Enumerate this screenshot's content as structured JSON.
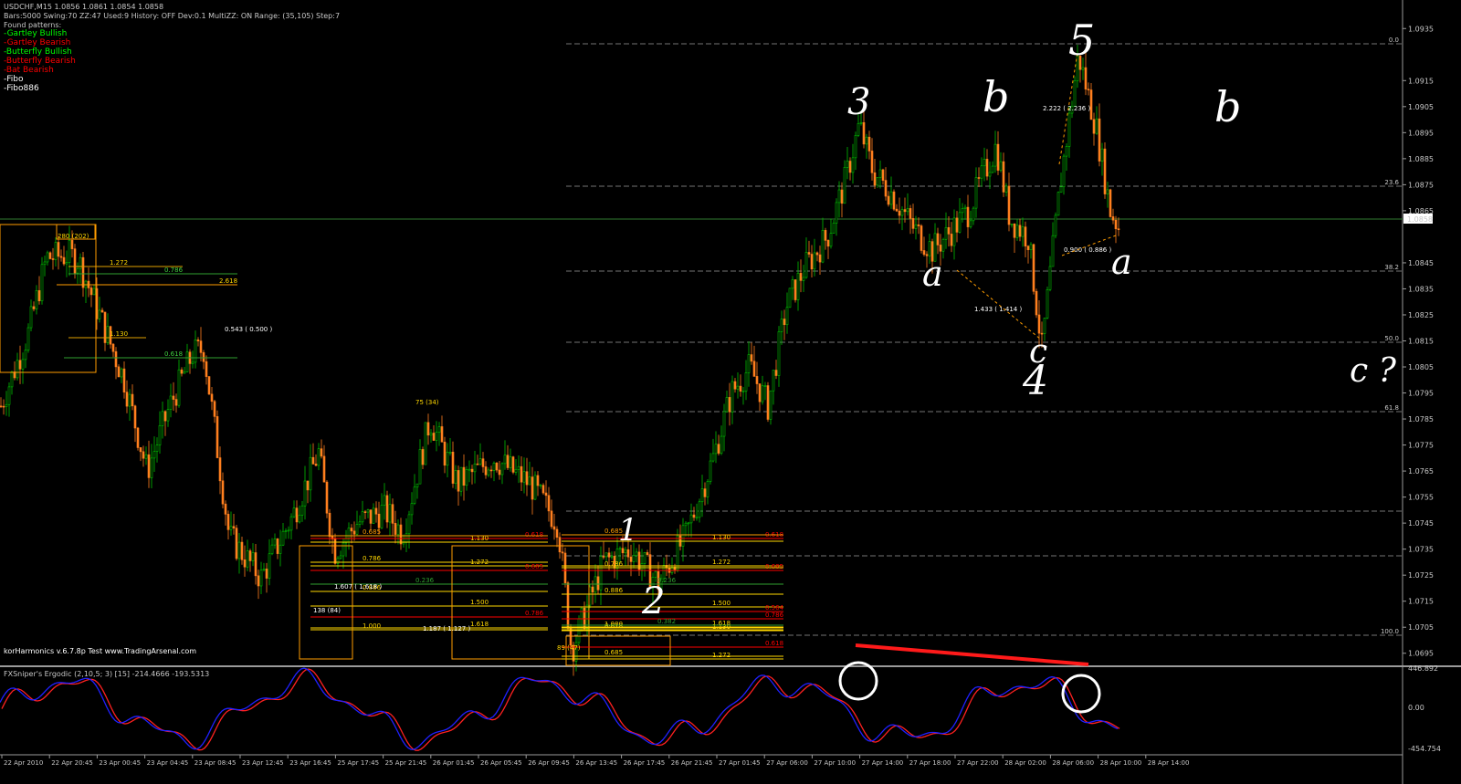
{
  "header": {
    "line1": "USDCHF,M15  1.0856 1.0861 1.0854 1.0858",
    "line2": "Bars:5000  Swing:70  ZZ:47  Used:9  History: OFF Dev:0.1  MultiZZ: ON  Range: (35,105)  Step:7",
    "line3": "Found patterns:"
  },
  "patterns": [
    {
      "label": "-Gartley Bullish",
      "color": "#00ff00"
    },
    {
      "label": "-Gartley Bearish",
      "color": "#ff0000"
    },
    {
      "label": "-Butterfly Bullish",
      "color": "#00ff00"
    },
    {
      "label": "-Butterfly Bearish",
      "color": "#ff0000"
    },
    {
      "label": "-Bat Bearish",
      "color": "#ff0000"
    },
    {
      "label": "-Fibo",
      "color": "#ffffff"
    },
    {
      "label": "-Fibo886",
      "color": "#ffffff"
    }
  ],
  "footer_text": "korHarmonics v.6.7.8p Test www.TradingArsenal.com",
  "indicator": {
    "label": "FXSniper's Ergodic (2,10,5; 3) [15] -214.4666 -193.5313",
    "axis_labels": [
      "446.892",
      "0.00",
      "-454.754"
    ]
  },
  "price_axis": {
    "labels": [
      "1.0935",
      "1.0915",
      "1.0905",
      "1.0895",
      "1.0885",
      "1.0875",
      "1.0865",
      "1.0845",
      "1.0835",
      "1.0825",
      "1.0815",
      "1.0805",
      "1.0795",
      "1.0785",
      "1.0775",
      "1.0765",
      "1.0755",
      "1.0745",
      "1.0735",
      "1.0725",
      "1.0715",
      "1.0705",
      "1.0695"
    ],
    "current_price": "1.0858"
  },
  "fib_levels": [
    "0.0",
    "23.6",
    "38.2",
    "50.0",
    "61.8",
    "100.0"
  ],
  "time_axis": [
    "22 Apr 2010",
    "22 Apr 20:45",
    "23 Apr 00:45",
    "23 Apr 04:45",
    "23 Apr 08:45",
    "23 Apr 12:45",
    "23 Apr 16:45",
    "25 Apr 17:45",
    "25 Apr 21:45",
    "26 Apr 01:45",
    "26 Apr 05:45",
    "26 Apr 09:45",
    "26 Apr 13:45",
    "26 Apr 17:45",
    "26 Apr 21:45",
    "27 Apr 01:45",
    "27 Apr 06:00",
    "27 Apr 10:00",
    "27 Apr 14:00",
    "27 Apr 18:00",
    "27 Apr 22:00",
    "28 Apr 02:00",
    "28 Apr 06:00",
    "28 Apr 10:00",
    "28 Apr 14:00"
  ],
  "wave_labels": {
    "w1": "1",
    "w2": "2",
    "w3": "3",
    "w4": "4",
    "w5": "5",
    "a1": "a",
    "b1": "b",
    "c1": "c",
    "a2": "a",
    "b2": "b",
    "c2": "c ?"
  },
  "ratio_labels": {
    "r1": "2.222 ( 2.236 )",
    "r2": "0.900 ( 0.886 )",
    "r3": "1.433 ( 1.414 )",
    "r4": "0.543 ( 0.500 )",
    "r5": "75 (34)",
    "r6": "280 (202)",
    "r7": "138 (84)",
    "r8": "1.607 ( 1.618 )",
    "r9": "1.187 ( 1.127 )",
    "r10": "89 (47)"
  },
  "harmonic_levels": {
    "h1": [
      "1.272",
      "0.786",
      "2.618",
      "1.130",
      "0.618"
    ],
    "h2": [
      "0.685",
      "1.130",
      "0.618",
      "0.786",
      "1.272",
      "0.685",
      "1.500",
      "0.618",
      "0.786",
      "1.000",
      "1.618",
      "0.236"
    ],
    "h3": [
      "0.685",
      "1.130",
      "0.618",
      "0.786",
      "1.272",
      "0.685",
      "0.886",
      "1.500",
      "0.564",
      "0.382",
      "0.786",
      "1.000",
      "1.618",
      "0.618",
      "1.130",
      "0.685",
      "0.618",
      "1.272",
      "0.236"
    ]
  },
  "colors": {
    "bull": "#00c000",
    "bear": "#ff7f1e",
    "pattern_fill": "#3ea06c",
    "red": "#ff0000",
    "indicator_a": "#2020ff",
    "indicator_b": "#ff2020"
  },
  "chart_data": {
    "type": "candlestick",
    "title": "USDCHF,M15",
    "ylim": [
      1.069,
      1.094
    ],
    "points": [
      [
        0,
        1.079
      ],
      [
        30,
        1.0818
      ],
      [
        50,
        1.0847
      ],
      [
        75,
        1.0848
      ],
      [
        85,
        1.0846
      ],
      [
        135,
        1.08
      ],
      [
        160,
        1.0765
      ],
      [
        185,
        1.079
      ],
      [
        210,
        1.081
      ],
      [
        222,
        1.0812
      ],
      [
        250,
        1.074
      ],
      [
        285,
        1.0724
      ],
      [
        320,
        1.0748
      ],
      [
        348,
        1.0772
      ],
      [
        365,
        1.0734
      ],
      [
        390,
        1.0745
      ],
      [
        420,
        1.075
      ],
      [
        440,
        1.0741
      ],
      [
        470,
        1.0785
      ],
      [
        500,
        1.076
      ],
      [
        540,
        1.077
      ],
      [
        580,
        1.076
      ],
      [
        610,
        1.0745
      ],
      [
        625,
        1.0696
      ],
      [
        660,
        1.073
      ],
      [
        690,
        1.0735
      ],
      [
        720,
        1.0722
      ],
      [
        750,
        1.074
      ],
      [
        780,
        1.077
      ],
      [
        800,
        1.0795
      ],
      [
        820,
        1.0805
      ],
      [
        840,
        1.079
      ],
      [
        860,
        1.0828
      ],
      [
        880,
        1.0843
      ],
      [
        905,
        1.0855
      ],
      [
        925,
        1.0877
      ],
      [
        940,
        1.0898
      ],
      [
        955,
        1.088
      ],
      [
        975,
        1.0872
      ],
      [
        1000,
        1.0858
      ],
      [
        1020,
        1.085
      ],
      [
        1040,
        1.0857
      ],
      [
        1060,
        1.0865
      ],
      [
        1075,
        1.0878
      ],
      [
        1090,
        1.089
      ],
      [
        1105,
        1.0862
      ],
      [
        1125,
        1.0855
      ],
      [
        1140,
        1.0812
      ],
      [
        1160,
        1.0875
      ],
      [
        1180,
        1.0925
      ],
      [
        1200,
        1.0896
      ],
      [
        1215,
        1.0865
      ],
      [
        1225,
        1.0858
      ]
    ]
  }
}
